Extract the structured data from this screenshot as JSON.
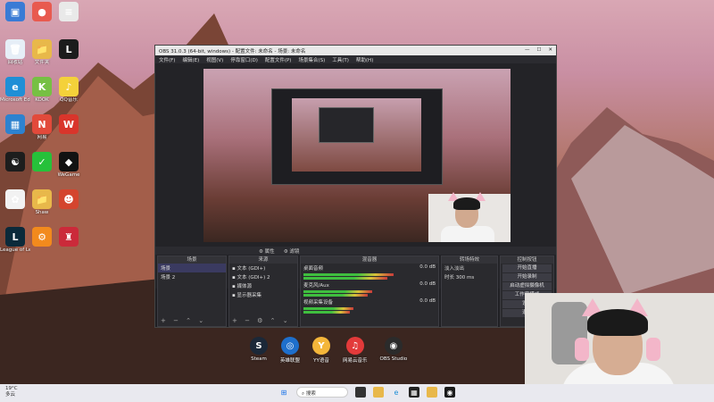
{
  "desktop_icons": [
    {
      "label": "",
      "color": "#3a7bd5",
      "glyph": "▣"
    },
    {
      "label": "",
      "color": "#e85a4f",
      "glyph": "●"
    },
    {
      "label": "",
      "color": "#e9e9e9",
      "glyph": "≡"
    },
    {
      "label": "回收站",
      "color": "#e6eef7",
      "glyph": "🗑"
    },
    {
      "label": "文件夹",
      "color": "#e8b84a",
      "glyph": "📁"
    },
    {
      "label": "",
      "color": "#1c1c1c",
      "glyph": "L"
    },
    {
      "label": "Microsoft Edge",
      "color": "#1f8fd6",
      "glyph": "e"
    },
    {
      "label": "KOOK",
      "color": "#76c043",
      "glyph": "K"
    },
    {
      "label": "QQ音乐",
      "color": "#f4d13a",
      "glyph": "♪"
    },
    {
      "label": "",
      "color": "#2d82cf",
      "glyph": "▦"
    },
    {
      "label": "网易",
      "color": "#e24a3b",
      "glyph": "N"
    },
    {
      "label": "",
      "color": "#d9352b",
      "glyph": "W"
    },
    {
      "label": "",
      "color": "#1d1d1d",
      "glyph": "☯"
    },
    {
      "label": "",
      "color": "#26c13a",
      "glyph": "✓"
    },
    {
      "label": "WeGame",
      "color": "#121212",
      "glyph": "◆"
    },
    {
      "label": "",
      "color": "#f2f2f2",
      "glyph": "✿"
    },
    {
      "label": "Shaw",
      "color": "#e8b84a",
      "glyph": "📁"
    },
    {
      "label": "",
      "color": "#d4452e",
      "glyph": "☻"
    },
    {
      "label": "League of Legends",
      "color": "#0b2a3a",
      "glyph": "L"
    },
    {
      "label": "",
      "color": "#f28a1d",
      "glyph": "⚙"
    },
    {
      "label": "",
      "color": "#cb2a3a",
      "glyph": "♜"
    }
  ],
  "obs": {
    "title": "OBS 31.0.3 (64-bit, windows) - 配置文件: 未命名 - 场景: 未命名",
    "menu": [
      "文件(F)",
      "编辑(E)",
      "视图(V)",
      "停靠窗口(D)",
      "配置文件(P)",
      "场景集合(S)",
      "工具(T)",
      "帮助(H)"
    ],
    "dock_labels": [
      "场景",
      "来源",
      "混音器",
      "转场特效",
      "控制按钮"
    ],
    "source_toolbar": [
      "⚙ 属性",
      "⚙ 滤镜"
    ],
    "scenes": [
      "场景",
      "场景 2"
    ],
    "sources": [
      "文本 (GDI+)",
      "文本 (GDI+) 2",
      "媒体源",
      "显示器采集"
    ],
    "mixer": [
      {
        "name": "桌面音频",
        "db": "0.0 dB",
        "level": 0.72
      },
      {
        "name": "麦克风/Aux",
        "db": "0.0 dB",
        "level": 0.55
      },
      {
        "name": "视频采集设备",
        "db": "0.0 dB",
        "level": 0.4
      }
    ],
    "transition": {
      "name": "淡入淡出",
      "duration_label": "时长",
      "duration": "300 ms"
    },
    "controls": [
      "开始直播",
      "开始录制",
      "启动虚拟摄像机",
      "工作室模式",
      "设置",
      "退出"
    ]
  },
  "taskbar_apps": [
    {
      "label": "Steam",
      "color": "#1b2838",
      "glyph": "S"
    },
    {
      "label": "英雄联盟",
      "color": "#1e6fcc",
      "glyph": "◎"
    },
    {
      "label": "YY语音",
      "color": "#f4b63a",
      "glyph": "Y"
    },
    {
      "label": "网易云音乐",
      "color": "#e33a3a",
      "glyph": "♫"
    },
    {
      "label": "OBS Studio",
      "color": "#2b2b2b",
      "glyph": "◉"
    }
  ],
  "weather": {
    "temp": "19°C",
    "desc": "多云"
  },
  "search_text": "搜索"
}
